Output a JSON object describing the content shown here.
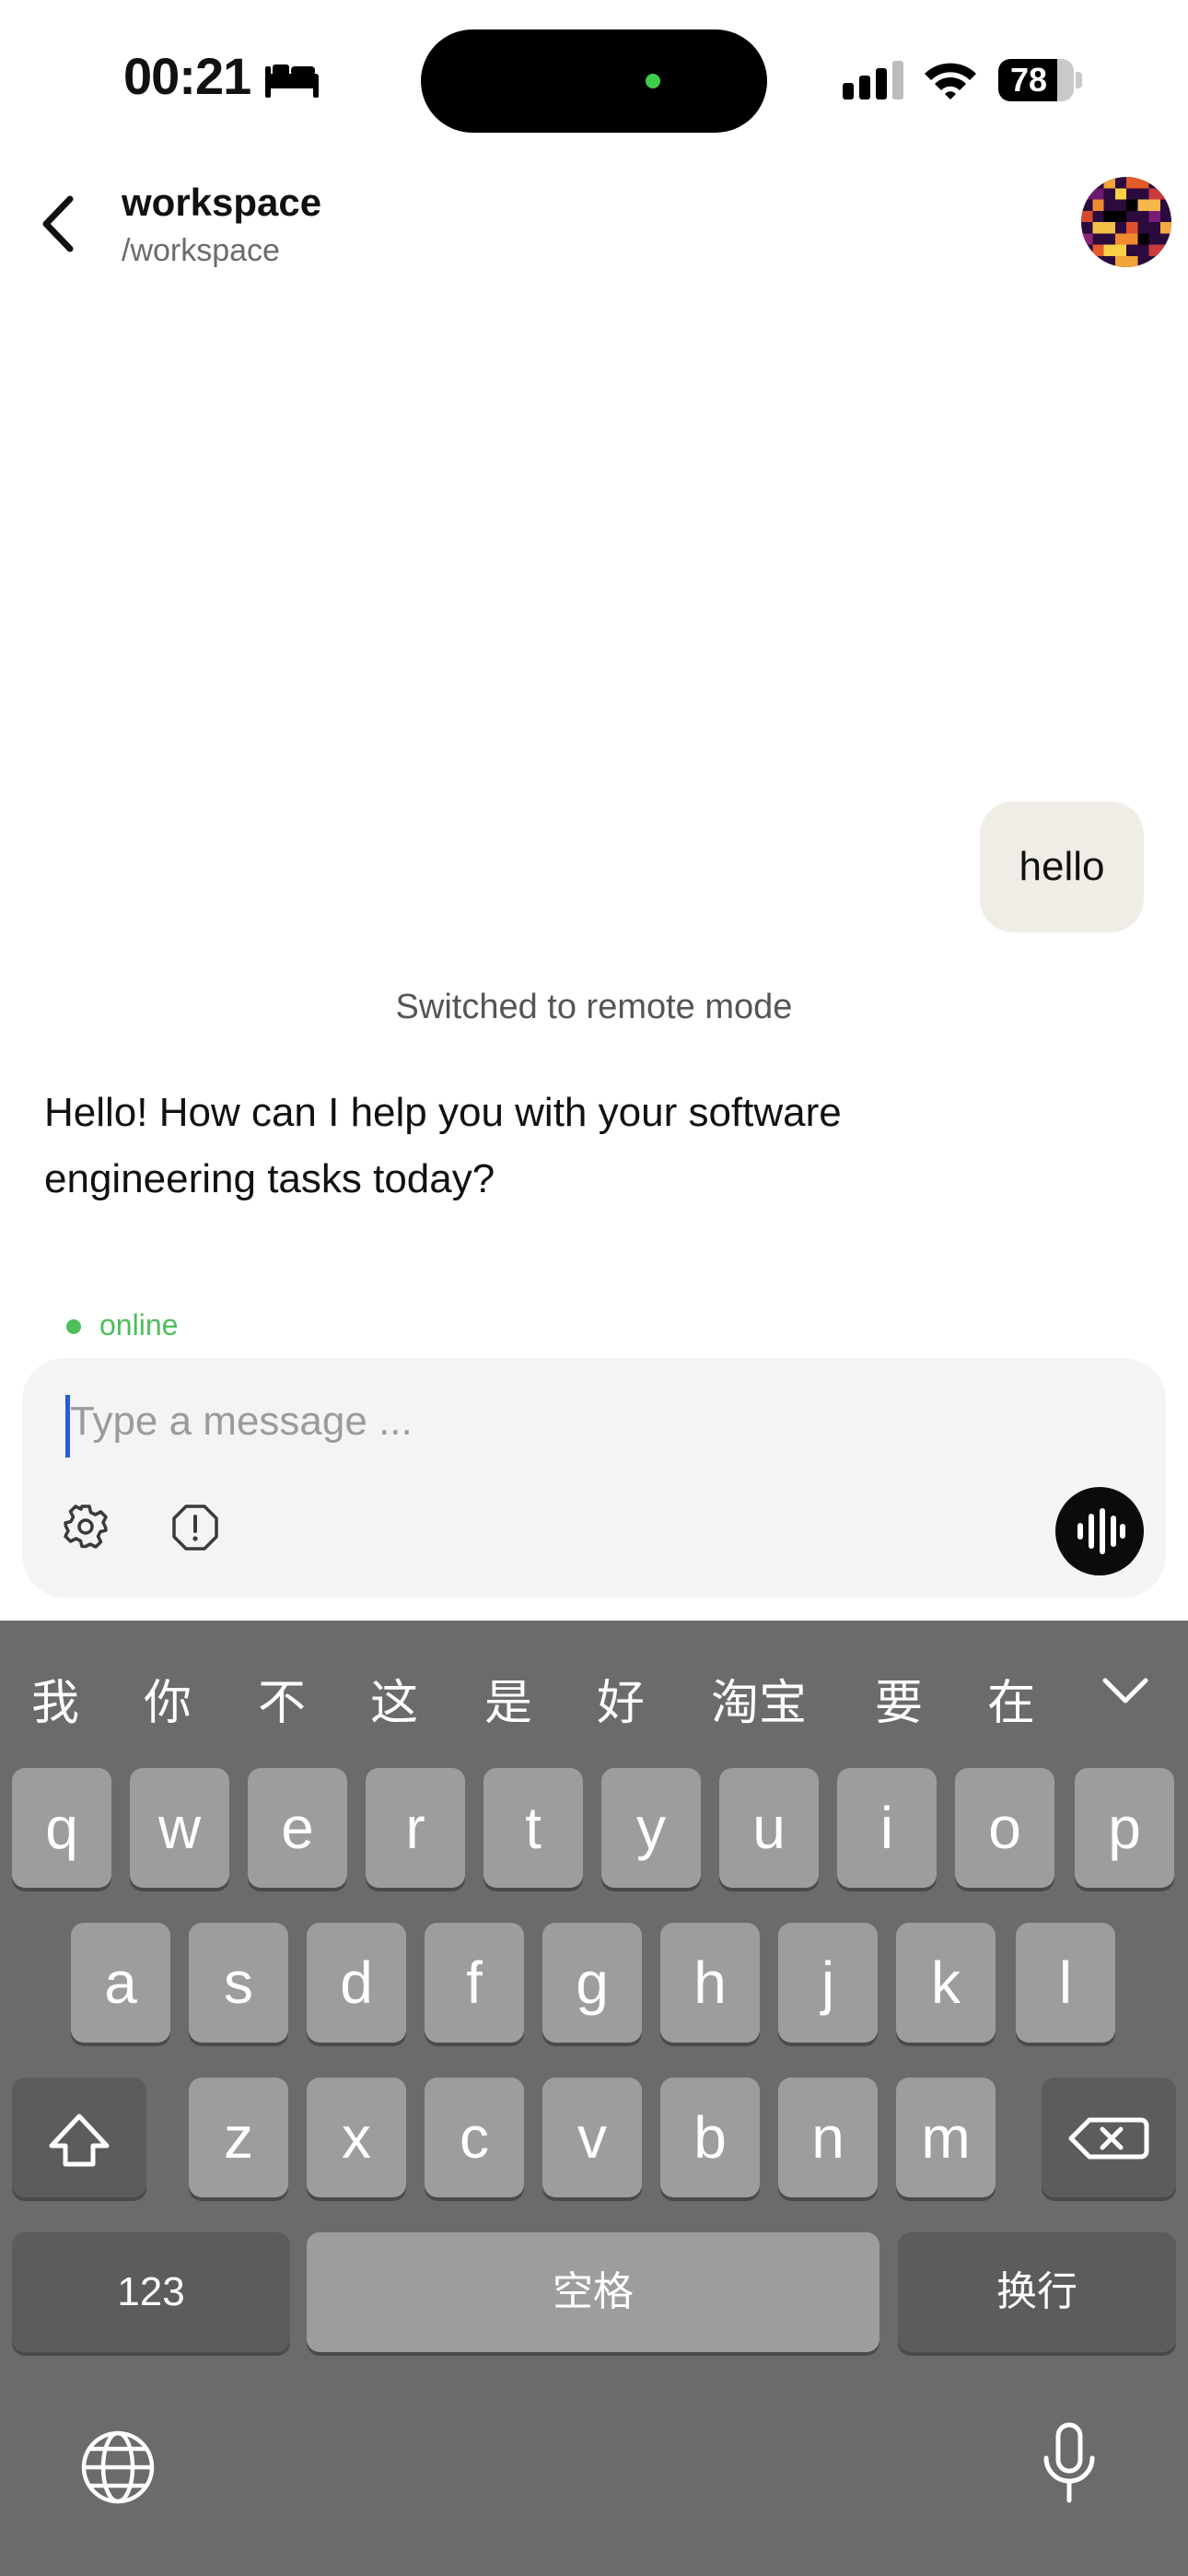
{
  "status_bar": {
    "time": "00:21",
    "battery": "78",
    "battery_fraction": 0.78
  },
  "header": {
    "title": "workspace",
    "subtitle": "/workspace"
  },
  "messages": {
    "user": "hello",
    "system": "Switched to remote mode",
    "assistant": "Hello! How can I help you with your software engineering tasks today?"
  },
  "connection": {
    "status": "online"
  },
  "composer": {
    "placeholder": "Type a message ..."
  },
  "keyboard": {
    "candidates": [
      "我",
      "你",
      "不",
      "这",
      "是",
      "好",
      "淘宝",
      "要",
      "在"
    ],
    "row1": [
      "q",
      "w",
      "e",
      "r",
      "t",
      "y",
      "u",
      "i",
      "o",
      "p"
    ],
    "row2": [
      "a",
      "s",
      "d",
      "f",
      "g",
      "h",
      "j",
      "k",
      "l"
    ],
    "row3": [
      "z",
      "x",
      "c",
      "v",
      "b",
      "n",
      "m"
    ],
    "numbers": "123",
    "space": "空格",
    "return": "换行"
  },
  "colors": {
    "accent_online": "#4cbe5a",
    "caret": "#2a5bd7",
    "bubble": "#f0ede6",
    "keyboard": "#6b6b6b"
  }
}
